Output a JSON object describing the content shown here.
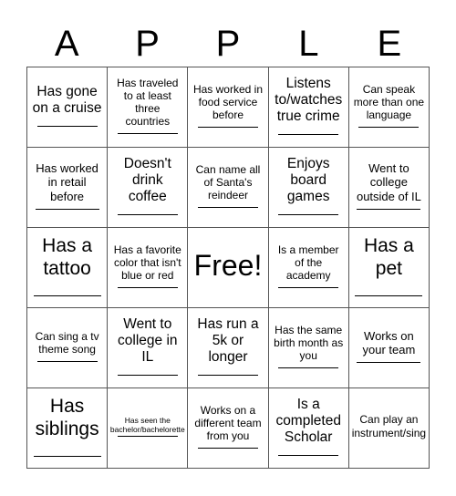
{
  "header": {
    "letters": [
      "A",
      "P",
      "P",
      "L",
      "E"
    ]
  },
  "cells": [
    {
      "text": "Has gone on a cruise",
      "size": "l",
      "line": true
    },
    {
      "text": "Has traveled to at least three countries",
      "size": "s",
      "line": true
    },
    {
      "text": "Has worked in food service before",
      "size": "s",
      "line": true
    },
    {
      "text": "Listens to/watches true crime",
      "size": "l",
      "line": true
    },
    {
      "text": "Can speak more than one language",
      "size": "s",
      "line": true
    },
    {
      "text": "Has worked in retail before",
      "size": "m",
      "line": true
    },
    {
      "text": "Doesn't drink coffee",
      "size": "l",
      "line": true
    },
    {
      "text": "Can name all of Santa's reindeer",
      "size": "s",
      "line": true
    },
    {
      "text": "Enjoys board games",
      "size": "l",
      "line": true
    },
    {
      "text": "Went to college outside of IL",
      "size": "m",
      "line": true
    },
    {
      "text": "Has a tattoo",
      "size": "xl",
      "line": true
    },
    {
      "text": "Has a favorite color that isn't blue or red",
      "size": "s",
      "line": true
    },
    {
      "text": "Free!",
      "size": "free",
      "line": false
    },
    {
      "text": "Is a member of the academy",
      "size": "s",
      "line": true
    },
    {
      "text": "Has a pet",
      "size": "xl",
      "line": true
    },
    {
      "text": "Can sing a tv theme song",
      "size": "s",
      "line": true
    },
    {
      "text": "Went to college in IL",
      "size": "l",
      "line": true
    },
    {
      "text": "Has run a 5k or longer",
      "size": "l",
      "line": true
    },
    {
      "text": "Has the same birth month as you",
      "size": "s",
      "line": true
    },
    {
      "text": "Works on your team",
      "size": "m",
      "line": true
    },
    {
      "text": "Has siblings",
      "size": "xl",
      "line": true
    },
    {
      "text": "Has seen the bachelor/bachelorette",
      "size": "xs",
      "line": true
    },
    {
      "text": "Works on a different team from you",
      "size": "s",
      "line": true
    },
    {
      "text": "Is a completed Scholar",
      "size": "l",
      "line": true
    },
    {
      "text": "Can play an instrument/sing",
      "size": "s",
      "line": false
    }
  ]
}
